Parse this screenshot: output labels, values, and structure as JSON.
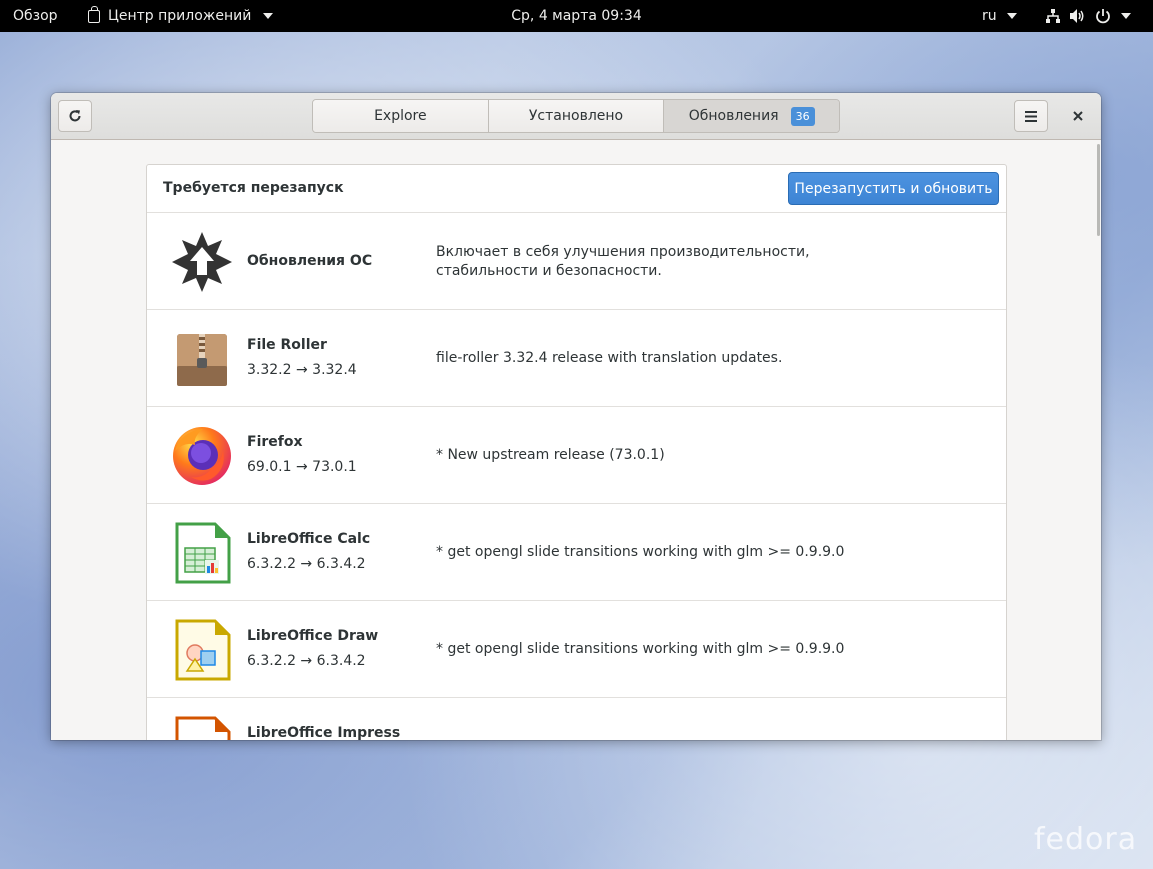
{
  "topbar": {
    "activities": "Обзор",
    "app_menu": "Центр приложений",
    "clock": "Ср, 4 марта  09:34",
    "language": "ru"
  },
  "window": {
    "tabs": [
      {
        "label": "Explore"
      },
      {
        "label": "Установлено"
      },
      {
        "label": "Обновления",
        "badge": "36"
      }
    ],
    "section_title": "Требуется перезапуск",
    "restart_button": "Перезапустить и обновить",
    "updates": [
      {
        "name": "Обновления ОС",
        "version": "",
        "description": "Включает в себя улучшения производительности, стабильности и безопасности.",
        "icon": "os-update-icon"
      },
      {
        "name": "File Roller",
        "version": "3.32.2 → 3.32.4",
        "description": "file-roller 3.32.4 release with translation updates.",
        "icon": "archive-icon"
      },
      {
        "name": "Firefox",
        "version": "69.0.1 → 73.0.1",
        "description": "* New upstream release (73.0.1)",
        "icon": "firefox-icon"
      },
      {
        "name": "LibreOffice Calc",
        "version": "6.3.2.2 → 6.3.4.2",
        "description": "* get opengl slide transitions working with glm >= 0.9.9.0",
        "icon": "calc-icon"
      },
      {
        "name": "LibreOffice Draw",
        "version": "6.3.2.2 → 6.3.4.2",
        "description": "* get opengl slide transitions working with glm >= 0.9.9.0",
        "icon": "draw-icon"
      },
      {
        "name": "LibreOffice Impress",
        "version": "",
        "description": "",
        "icon": "impress-icon"
      }
    ]
  },
  "wallpaper_logo": "fedora",
  "colors": {
    "accent": "#3d84d4",
    "topbar": "#000000"
  }
}
